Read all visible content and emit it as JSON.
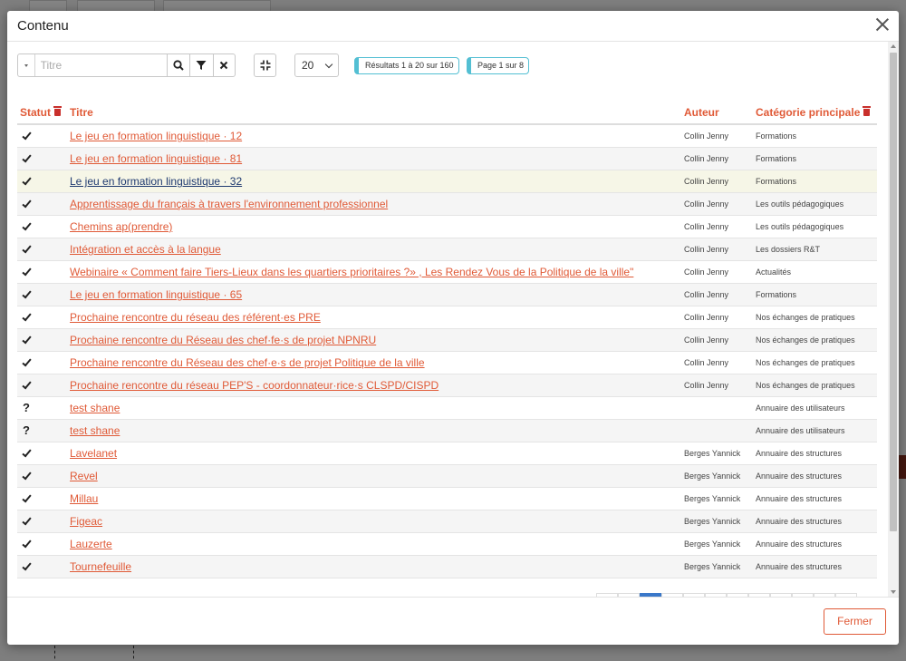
{
  "modal": {
    "title": "Contenu",
    "close_label": "Fermer"
  },
  "toolbar": {
    "search_placeholder": "Titre",
    "page_size": "20",
    "results_badge": "Résultats 1 à 20 sur 160",
    "page_badge": "Page 1 sur 8"
  },
  "columns": {
    "status": "Statut",
    "title": "Titre",
    "author": "Auteur",
    "category": "Catégorie principale"
  },
  "rows": [
    {
      "status": "check",
      "title": "Le jeu en formation linguistique · 12",
      "author": "Collin Jenny",
      "category": "Formations"
    },
    {
      "status": "check",
      "title": "Le jeu en formation linguistique · 81",
      "author": "Collin Jenny",
      "category": "Formations"
    },
    {
      "status": "check",
      "title": "Le jeu en formation linguistique · 32",
      "author": "Collin Jenny",
      "category": "Formations",
      "highlighted": true
    },
    {
      "status": "check",
      "title": "Apprentissage du français à travers l'environnement professionnel",
      "author": "Collin Jenny",
      "category": "Les outils pédagogiques"
    },
    {
      "status": "check",
      "title": "Chemins ap(prendre)",
      "author": "Collin Jenny",
      "category": "Les outils pédagogiques"
    },
    {
      "status": "check",
      "title": "Intégration et accès à la langue",
      "author": "Collin Jenny",
      "category": "Les dossiers R&T"
    },
    {
      "status": "check",
      "title": "Webinaire « Comment faire Tiers-Lieux dans les quartiers prioritaires ?» , Les Rendez Vous de la Politique de la ville\"",
      "author": "Collin Jenny",
      "category": "Actualités"
    },
    {
      "status": "check",
      "title": "Le jeu en formation linguistique · 65",
      "author": "Collin Jenny",
      "category": "Formations"
    },
    {
      "status": "check",
      "title": "Prochaine rencontre du réseau des référent·es PRE",
      "author": "Collin Jenny",
      "category": "Nos échanges de pratiques"
    },
    {
      "status": "check",
      "title": "Prochaine rencontre du Réseau des chef·fe·s de projet NPNRU",
      "author": "Collin Jenny",
      "category": "Nos échanges de pratiques"
    },
    {
      "status": "check",
      "title": "Prochaine rencontre du Réseau des chef·e·s de projet Politique de la ville",
      "author": "Collin Jenny",
      "category": "Nos échanges de pratiques"
    },
    {
      "status": "check",
      "title": "Prochaine rencontre du réseau PEP'S - coordonnateur·rice·s CLSPD/CISPD",
      "author": "Collin Jenny",
      "category": "Nos échanges de pratiques"
    },
    {
      "status": "question",
      "title": "test shane",
      "author": "",
      "category": "Annuaire des utilisateurs"
    },
    {
      "status": "question",
      "title": "test shane",
      "author": "",
      "category": "Annuaire des utilisateurs"
    },
    {
      "status": "check",
      "title": "Lavelanet",
      "author": "Berges Yannick",
      "category": "Annuaire des structures"
    },
    {
      "status": "check",
      "title": "Revel",
      "author": "Berges Yannick",
      "category": "Annuaire des structures"
    },
    {
      "status": "check",
      "title": "Millau",
      "author": "Berges Yannick",
      "category": "Annuaire des structures"
    },
    {
      "status": "check",
      "title": "Figeac",
      "author": "Berges Yannick",
      "category": "Annuaire des structures"
    },
    {
      "status": "check",
      "title": "Lauzerte",
      "author": "Berges Yannick",
      "category": "Annuaire des structures"
    },
    {
      "status": "check",
      "title": "Tournefeuille",
      "author": "Berges Yannick",
      "category": "Annuaire des structures"
    }
  ],
  "pagination": {
    "pages": 12,
    "active_index": 2
  }
}
